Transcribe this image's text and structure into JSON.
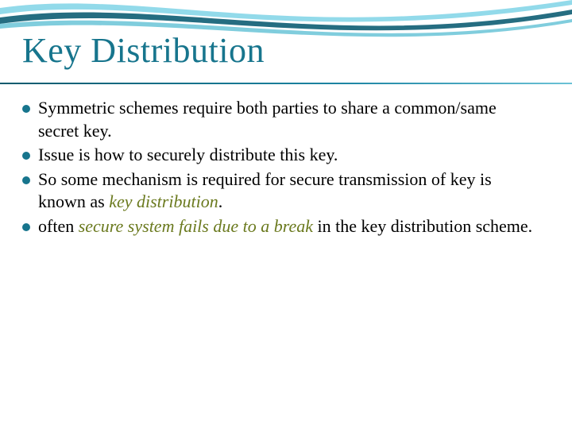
{
  "title": "Key Distribution",
  "bullets": [
    {
      "pre": "Symmetric schemes require both parties to share a common/same secret key.",
      "em": "",
      "post": ""
    },
    {
      "pre": "Issue is how to securely distribute this key.",
      "em": "",
      "post": ""
    },
    {
      "pre": "So some mechanism is required for secure transmission of key is known as ",
      "em": "key distribution",
      "post": "."
    },
    {
      "pre": "often ",
      "em": "secure system fails due to a break",
      "post": " in the key distribution scheme."
    }
  ]
}
